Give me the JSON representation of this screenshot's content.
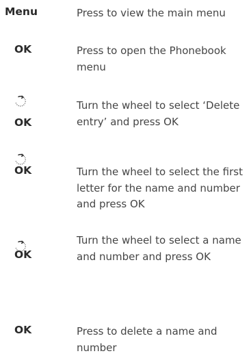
{
  "steps": [
    {
      "key": "Menu",
      "has_wheel": false,
      "description": "Press to view the main menu"
    },
    {
      "key": "OK",
      "has_wheel": false,
      "description": "Press to open the Phonebook menu"
    },
    {
      "key": "OK",
      "has_wheel": true,
      "wheel_icon": "wheel-turn-icon",
      "description": "Turn the wheel to select ‘Delete entry’ and press OK"
    },
    {
      "key": "OK",
      "has_wheel": true,
      "wheel_icon": "wheel-turn-icon",
      "description": "Turn the wheel to select the first letter for the name and number and press OK"
    },
    {
      "key": "OK",
      "has_wheel": true,
      "wheel_icon": "wheel-turn-icon",
      "description": "Turn the wheel to select a name and number and press OK"
    },
    {
      "key": "OK",
      "has_wheel": false,
      "description": "Press to delete a name and number"
    }
  ]
}
